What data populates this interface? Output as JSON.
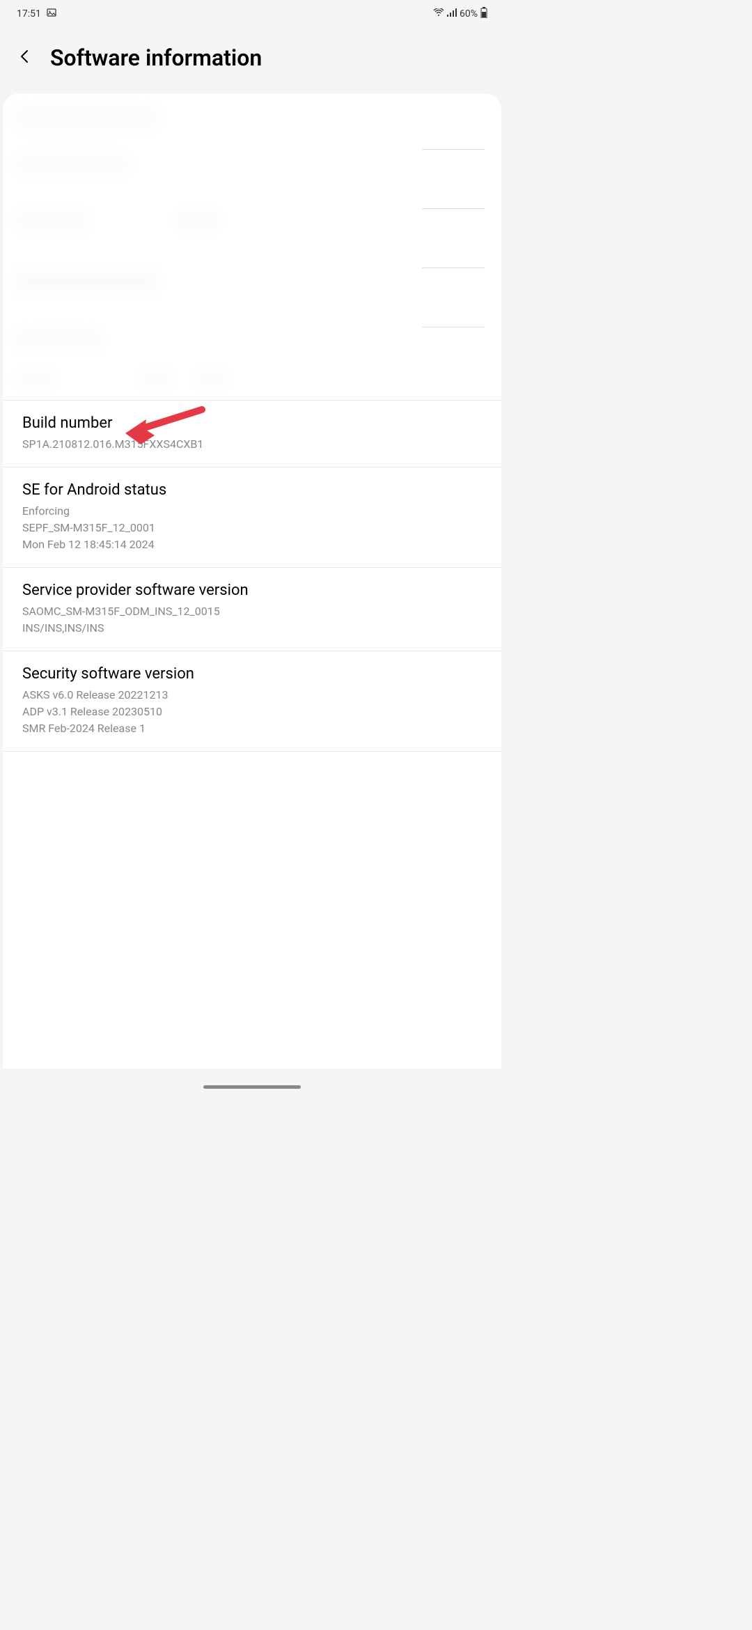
{
  "status_bar": {
    "time": "17:51",
    "battery_percent": "60%"
  },
  "header": {
    "title": "Software information"
  },
  "items": {
    "build_number": {
      "title": "Build number",
      "value": "SP1A.210812.016.M315FXXS4CXB1"
    },
    "se_android": {
      "title": "SE for Android status",
      "value": "Enforcing\nSEPF_SM-M315F_12_0001\nMon Feb 12 18:45:14 2024"
    },
    "service_provider": {
      "title": "Service provider software version",
      "value": "SAOMC_SM-M315F_ODM_INS_12_0015\nINS/INS,INS/INS"
    },
    "security_software": {
      "title": "Security software version",
      "value": "ASKS v6.0 Release 20221213\nADP v3.1 Release 20230510\nSMR Feb-2024 Release 1"
    }
  }
}
